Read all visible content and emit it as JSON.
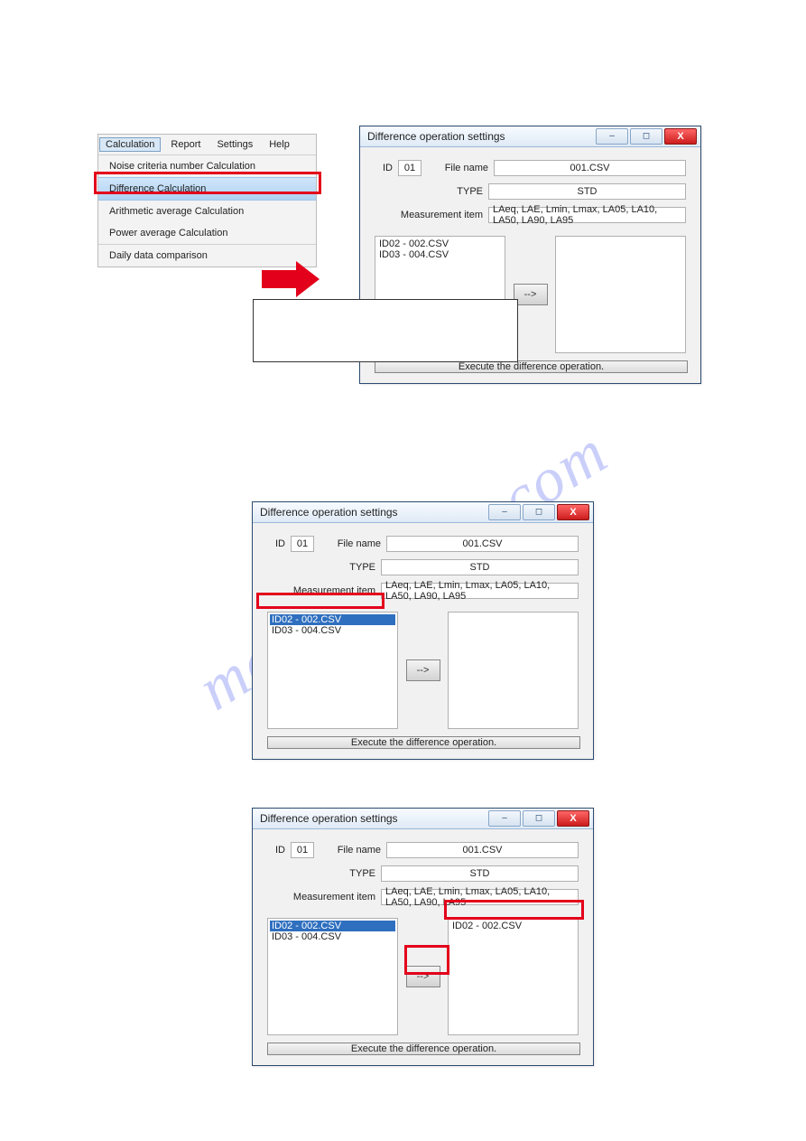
{
  "watermark": "manualshive.com",
  "menu": {
    "bar": [
      "Calculation",
      "Report",
      "Settings",
      "Help"
    ],
    "items": [
      "Noise criteria number Calculation",
      "Difference Calculation",
      "Arithmetic average Calculation",
      "Power average Calculation",
      "Daily data comparison"
    ]
  },
  "dialog": {
    "title": "Difference operation settings",
    "id_label": "ID",
    "id_value": "01",
    "file_label": "File name",
    "file_value": "001.CSV",
    "type_label": "TYPE",
    "type_value": "STD",
    "meas_label": "Measurement item",
    "meas_value": "LAeq, LAE, Lmin, Lmax, LA05, LA10, LA50, LA90, LA95",
    "arrow_btn": "-->",
    "exec": "Execute the difference operation."
  },
  "lists": {
    "d1_left": [
      "ID02 - 002.CSV",
      "ID03 - 004.CSV"
    ],
    "d2_left": [
      "ID02 - 002.CSV",
      "ID03 - 004.CSV"
    ],
    "d3_left": [
      "ID02 - 002.CSV",
      "ID03 - 004.CSV"
    ],
    "d3_right": [
      "ID02 - 002.CSV"
    ]
  }
}
